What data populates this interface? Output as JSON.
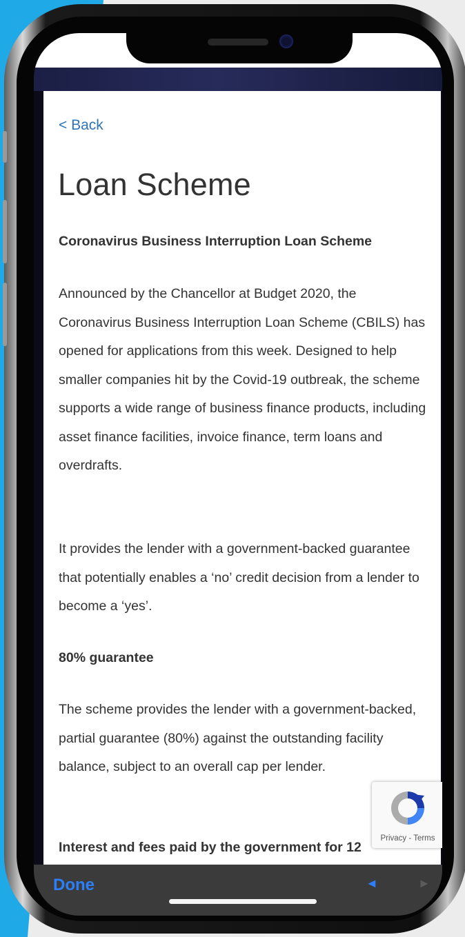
{
  "colors": {
    "link": "#2f73b6",
    "toolbar_accent": "#2d7ff9",
    "page_text": "#333333",
    "background_accent": "#1fa9e6"
  },
  "nav": {
    "back_label": "< Back"
  },
  "page": {
    "title": "Loan Scheme",
    "sections": [
      {
        "type": "heading",
        "text": "Coronavirus Business Interruption Loan Scheme"
      },
      {
        "type": "paragraph",
        "text": "Announced by the Chancellor at Budget 2020, the Coronavirus Business Interruption Loan Scheme (CBILS) has opened for applications from this week. Designed to help smaller companies hit by the Covid-19 outbreak, the scheme supports a wide range of business finance products, including asset finance facilities, invoice finance, term loans and overdrafts."
      },
      {
        "type": "paragraph",
        "text": "It provides the lender with a government-backed guarantee that potentially enables a ‘no’ credit decision from a lender to become a ‘yes’."
      },
      {
        "type": "heading",
        "text": "80% guarantee"
      },
      {
        "type": "paragraph",
        "text": "The scheme provides the lender with a government-backed, partial guarantee (80%) against the outstanding facility balance, subject to an overall cap per lender."
      },
      {
        "type": "heading",
        "text": "Interest and fees paid by the government for 12"
      }
    ]
  },
  "recaptcha": {
    "links": "Privacy - Terms",
    "icon": "recaptcha-icon"
  },
  "toolbar": {
    "done_label": "Done",
    "prev_icon": "◄",
    "next_icon": "►"
  }
}
